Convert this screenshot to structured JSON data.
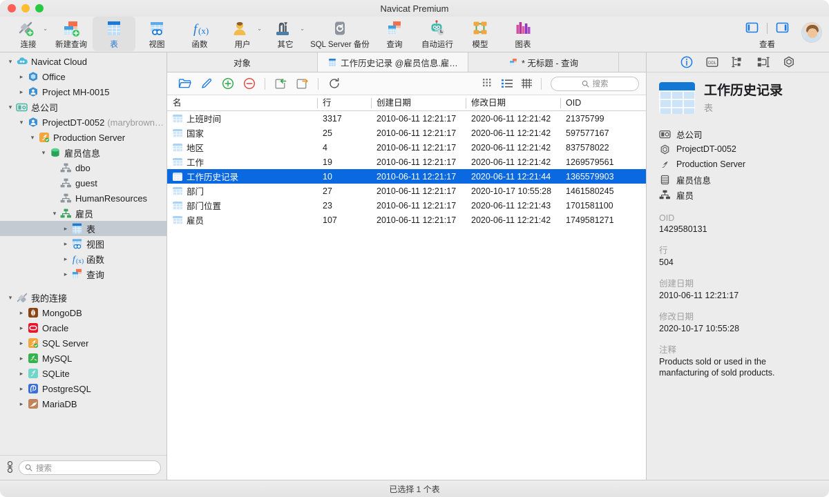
{
  "window": {
    "title": "Navicat Premium",
    "traffic": [
      "close",
      "minimize",
      "maximize"
    ]
  },
  "toolbar": {
    "items": [
      {
        "label": "连接",
        "icon": "connection-plug-icon",
        "caret": true,
        "active": false
      },
      {
        "label": "新建查询",
        "icon": "new-query-icon",
        "caret": false,
        "active": false
      },
      {
        "label": "表",
        "icon": "table-icon",
        "caret": false,
        "active": true
      },
      {
        "label": "视图",
        "icon": "view-icon",
        "caret": false,
        "active": false
      },
      {
        "label": "函数",
        "icon": "function-icon",
        "caret": false,
        "active": false
      },
      {
        "label": "用户",
        "icon": "user-icon",
        "caret": true,
        "active": false
      },
      {
        "label": "其它",
        "icon": "other-tools-icon",
        "caret": true,
        "active": false
      },
      {
        "label": "SQL Server 备份",
        "icon": "backup-icon",
        "caret": false,
        "active": false
      },
      {
        "label": "查询",
        "icon": "query-icon",
        "caret": false,
        "active": false
      },
      {
        "label": "自动运行",
        "icon": "automation-robot-icon",
        "caret": false,
        "active": false
      },
      {
        "label": "模型",
        "icon": "model-icon",
        "caret": false,
        "active": false
      },
      {
        "label": "图表",
        "icon": "chart-icon",
        "caret": false,
        "active": false
      }
    ],
    "view_group": {
      "label": "查看",
      "left_icon": "sidebar-left-panel-icon",
      "right_icon": "sidebar-right-panel-icon"
    },
    "avatar": "user-avatar"
  },
  "sidebar": {
    "search_placeholder": "搜索",
    "bottom_icon": "connection-status-icon",
    "tree": [
      {
        "indent": 0,
        "twist": "open",
        "icon": "navicat-cloud-icon",
        "label": "Navicat Cloud",
        "sub": "",
        "selected": false
      },
      {
        "indent": 1,
        "twist": "closed",
        "icon": "project-office-icon",
        "label": "Office",
        "sub": "",
        "selected": false
      },
      {
        "indent": 1,
        "twist": "closed",
        "icon": "project-icon",
        "label": "Project MH-0015",
        "sub": "",
        "selected": false
      },
      {
        "indent": 0,
        "twist": "open",
        "icon": "company-icon",
        "label": "总公司",
        "sub": "",
        "selected": false
      },
      {
        "indent": 1,
        "twist": "open",
        "icon": "project-icon",
        "label": "ProjectDT-0052",
        "sub": "(marybrown…",
        "selected": false
      },
      {
        "indent": 2,
        "twist": "open",
        "icon": "sqlserver-icon",
        "label": "Production Server",
        "sub": "",
        "selected": false
      },
      {
        "indent": 3,
        "twist": "open",
        "icon": "database-icon",
        "label": "雇员信息",
        "sub": "",
        "selected": false
      },
      {
        "indent": 4,
        "twist": "none",
        "icon": "schema-icon",
        "label": "dbo",
        "sub": "",
        "selected": false
      },
      {
        "indent": 4,
        "twist": "none",
        "icon": "schema-icon",
        "label": "guest",
        "sub": "",
        "selected": false
      },
      {
        "indent": 4,
        "twist": "none",
        "icon": "schema-icon",
        "label": "HumanResources",
        "sub": "",
        "selected": false
      },
      {
        "indent": 4,
        "twist": "open",
        "icon": "schema-green-icon",
        "label": "雇员",
        "sub": "",
        "selected": false
      },
      {
        "indent": 5,
        "twist": "closed",
        "icon": "table-icon",
        "label": "表",
        "sub": "",
        "selected": true
      },
      {
        "indent": 5,
        "twist": "closed",
        "icon": "view-icon",
        "label": "视图",
        "sub": "",
        "selected": false
      },
      {
        "indent": 5,
        "twist": "closed",
        "icon": "function-icon",
        "label": "函数",
        "sub": "",
        "selected": false
      },
      {
        "indent": 5,
        "twist": "closed",
        "icon": "query-icon",
        "label": "查询",
        "sub": "",
        "selected": false
      },
      {
        "indent": 0,
        "twist": "none",
        "icon": "",
        "label": "",
        "sub": "",
        "selected": false
      },
      {
        "indent": 0,
        "twist": "open",
        "icon": "my-connections-icon",
        "label": "我的连接",
        "sub": "",
        "selected": false
      },
      {
        "indent": 1,
        "twist": "closed",
        "icon": "mongodb-icon",
        "label": "MongoDB",
        "sub": "",
        "selected": false
      },
      {
        "indent": 1,
        "twist": "closed",
        "icon": "oracle-icon",
        "label": "Oracle",
        "sub": "",
        "selected": false
      },
      {
        "indent": 1,
        "twist": "closed",
        "icon": "sqlserver-icon",
        "label": "SQL Server",
        "sub": "",
        "selected": false
      },
      {
        "indent": 1,
        "twist": "closed",
        "icon": "mysql-icon",
        "label": "MySQL",
        "sub": "",
        "selected": false
      },
      {
        "indent": 1,
        "twist": "closed",
        "icon": "sqlite-icon",
        "label": "SQLite",
        "sub": "",
        "selected": false
      },
      {
        "indent": 1,
        "twist": "closed",
        "icon": "postgresql-icon",
        "label": "PostgreSQL",
        "sub": "",
        "selected": false
      },
      {
        "indent": 1,
        "twist": "closed",
        "icon": "mariadb-icon",
        "label": "MariaDB",
        "sub": "",
        "selected": false
      }
    ]
  },
  "tabs": [
    {
      "label": "对象",
      "icon": "",
      "active": false
    },
    {
      "label": "工作历史记录 @雇员信息.雇…",
      "icon": "table-icon",
      "active": true
    },
    {
      "label": "* 无标题 - 查询",
      "icon": "query-icon",
      "active": false
    }
  ],
  "objtoolbar": {
    "buttons": [
      {
        "name": "open-object-button",
        "icon": "folder-open-icon"
      },
      {
        "name": "design-object-button",
        "icon": "pencil-icon"
      },
      {
        "name": "new-object-button",
        "icon": "plus-circle-icon"
      },
      {
        "name": "delete-object-button",
        "icon": "minus-circle-icon"
      },
      {
        "name": "import-wizard-button",
        "icon": "import-arrow-icon"
      },
      {
        "name": "export-wizard-button",
        "icon": "export-arrow-icon"
      },
      {
        "name": "refresh-button",
        "icon": "refresh-icon"
      }
    ],
    "view_modes": [
      {
        "name": "icon-view-button",
        "icon": "grid-dots-icon",
        "active": false
      },
      {
        "name": "list-view-button",
        "icon": "list-icon",
        "active": true
      },
      {
        "name": "detail-view-button",
        "icon": "table-grid-icon",
        "active": false
      }
    ],
    "search_placeholder": "搜索"
  },
  "table": {
    "columns": [
      "名",
      "行",
      "创建日期",
      "修改日期",
      "OID"
    ],
    "rows": [
      {
        "name": "上班时间",
        "rows": "3317",
        "created": "2010-06-11 12:21:17",
        "modified": "2020-06-11 12:21:42",
        "oid": "21375799",
        "selected": false
      },
      {
        "name": "国家",
        "rows": "25",
        "created": "2010-06-11 12:21:17",
        "modified": "2020-06-11 12:21:42",
        "oid": "597577167",
        "selected": false
      },
      {
        "name": "地区",
        "rows": "4",
        "created": "2010-06-11 12:21:17",
        "modified": "2020-06-11 12:21:42",
        "oid": "837578022",
        "selected": false
      },
      {
        "name": "工作",
        "rows": "19",
        "created": "2010-06-11 12:21:17",
        "modified": "2020-06-11 12:21:42",
        "oid": "1269579561",
        "selected": false
      },
      {
        "name": "工作历史记录",
        "rows": "10",
        "created": "2010-06-11 12:21:17",
        "modified": "2020-06-11 12:21:44",
        "oid": "1365579903",
        "selected": true
      },
      {
        "name": "部门",
        "rows": "27",
        "created": "2010-06-11 12:21:17",
        "modified": "2020-10-17 10:55:28",
        "oid": "1461580245",
        "selected": false
      },
      {
        "name": "部门位置",
        "rows": "23",
        "created": "2010-06-11 12:21:17",
        "modified": "2020-06-11 12:21:43",
        "oid": "1701581100",
        "selected": false
      },
      {
        "name": "雇员",
        "rows": "107",
        "created": "2010-06-11 12:21:17",
        "modified": "2020-06-11 12:21:42",
        "oid": "1749581271",
        "selected": false
      }
    ]
  },
  "rightpane": {
    "tabs": [
      {
        "name": "info-tab",
        "icon": "info-circle-icon",
        "active": true
      },
      {
        "name": "ddl-tab",
        "icon": "ddl-icon",
        "active": false
      },
      {
        "name": "er-tab",
        "icon": "hierarchy-icon",
        "active": false
      },
      {
        "name": "relation-tab",
        "icon": "relation-icon",
        "active": false
      },
      {
        "name": "object-tab",
        "icon": "hexagon-icon",
        "active": false
      }
    ],
    "title": "工作历史记录",
    "subtitle": "表",
    "icon": "table-large-icon",
    "path": [
      {
        "icon": "company-icon",
        "label": "总公司"
      },
      {
        "icon": "hexagon-icon",
        "label": "ProjectDT-0052"
      },
      {
        "icon": "sqlserver-icon",
        "label": "Production Server"
      },
      {
        "icon": "database-icon",
        "label": "雇员信息"
      },
      {
        "icon": "schema-icon",
        "label": "雇员"
      }
    ],
    "fields": [
      {
        "label": "OID",
        "value": "1429580131"
      },
      {
        "label": "行",
        "value": "504"
      },
      {
        "label": "创建日期",
        "value": "2010-06-11 12:21:17"
      },
      {
        "label": "修改日期",
        "value": "2020-10-17 10:55:28"
      },
      {
        "label": "注释",
        "value": "Products sold or used in the manfacturing of sold products."
      }
    ]
  },
  "statusbar": {
    "text": "已选择 1 个表"
  },
  "colors": {
    "selection_blue": "#0a68e0",
    "tree_selection": "#c3cad2",
    "accent_blue": "#2878d8",
    "chrome_grey": "#ececec"
  }
}
